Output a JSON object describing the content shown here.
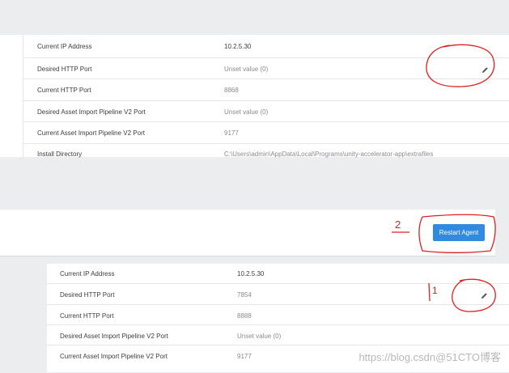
{
  "top_panel": {
    "rows": [
      {
        "label": "Current IP Address",
        "value": "10.2.5.30"
      },
      {
        "label": "Desired HTTP Port",
        "value": "Unset value (0)",
        "editable": true
      },
      {
        "label": "Current HTTP Port",
        "value": "8868"
      },
      {
        "label": "Desired Asset Import Pipeline V2 Port",
        "value": "Unset value (0)"
      },
      {
        "label": "Current Asset Import Pipeline V2 Port",
        "value": "9177"
      },
      {
        "label": "Install Directory",
        "value": "C:\\Users\\admin\\AppData\\Local\\Programs\\unity-accelerator-app\\extrafiles"
      }
    ]
  },
  "action_bar": {
    "restart_label": "Restart Agent"
  },
  "bottom_panel": {
    "rows": [
      {
        "label": "Current IP Address",
        "value": "10.2.5.30"
      },
      {
        "label": "Desired HTTP Port",
        "value": "7854",
        "editable": true
      },
      {
        "label": "Current HTTP Port",
        "value": "8888"
      },
      {
        "label": "Desired Asset Import Pipeline V2 Port",
        "value": "Unset value (0)"
      },
      {
        "label": "Current Asset Import Pipeline V2 Port",
        "value": "9177"
      }
    ]
  },
  "annotations": {
    "step2": "2",
    "step1": "1"
  },
  "watermark": "https://blog.csdn@51CTO博客",
  "colors": {
    "accent": "#2f8ae0",
    "annotation": "#e02020"
  }
}
